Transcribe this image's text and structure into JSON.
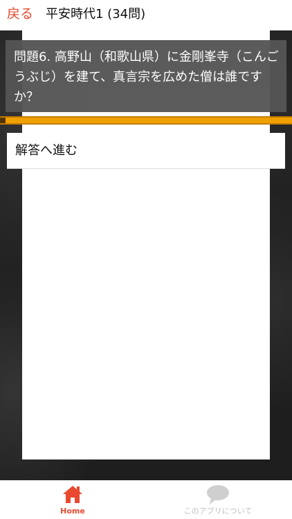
{
  "header": {
    "back_label": "戻る",
    "title": "平安時代1 (34問)"
  },
  "question": {
    "text": "問題6. 高野山（和歌山県）に金剛峯寺（こんごうぶじ）を建て、真言宗を広めた僧は誰ですか？"
  },
  "progress": {
    "fraction": 0.02
  },
  "answer_button": {
    "label": "解答へ進む"
  },
  "bottom_nav": {
    "items": [
      {
        "label": "Home",
        "icon": "home-icon",
        "active": true
      },
      {
        "label": "このアプリについて",
        "icon": "chat-bubble-icon",
        "active": false
      }
    ]
  },
  "colors": {
    "accent": "#e8492f",
    "progress_bar": "#f0a000",
    "question_bg": "#555555"
  }
}
